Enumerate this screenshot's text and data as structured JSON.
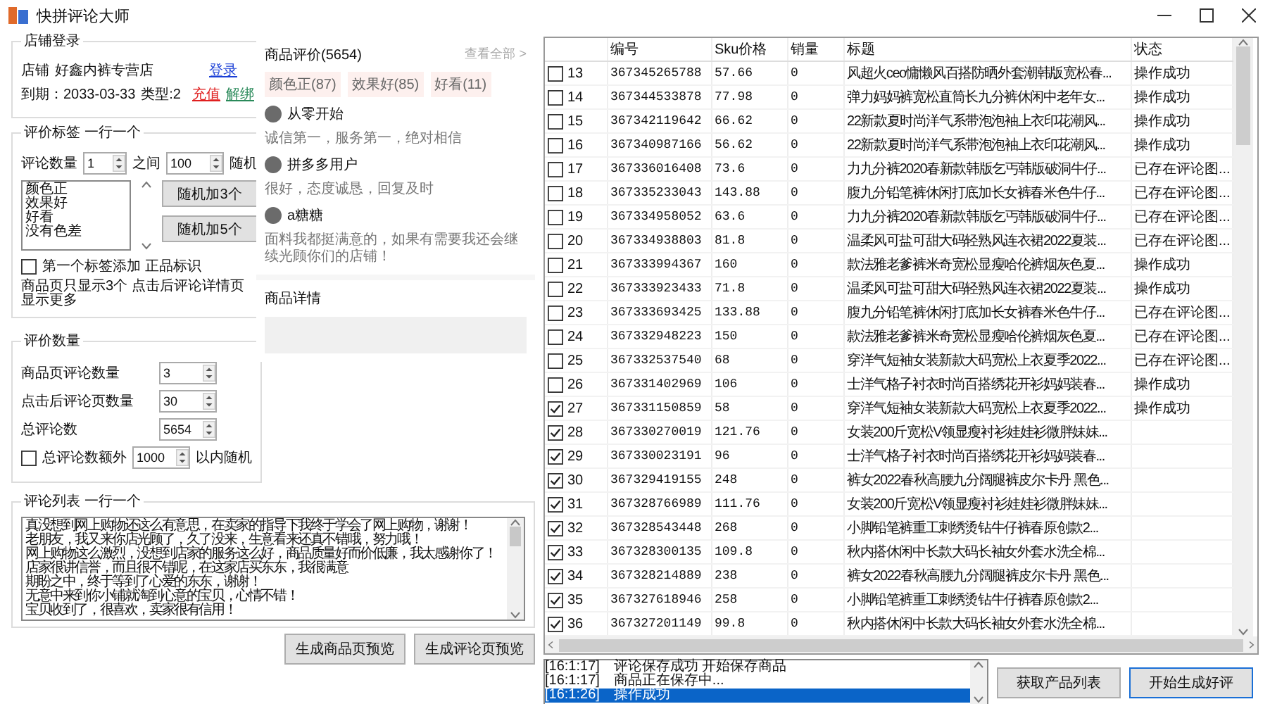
{
  "window": {
    "title": "快拼评论大师"
  },
  "shop_login": {
    "title": "店铺登录",
    "shop_label": "店铺",
    "shop_name": "好鑫内裤专营店",
    "login_link": "登录",
    "expiry": "到期：2033-03-33",
    "type": "类型:2",
    "recharge_link": "充值",
    "unbind_link": "解绑"
  },
  "tags_group": {
    "title": "评价标签 一行一个",
    "count_label": "评论数量",
    "min": "1",
    "between_label": "之间",
    "max": "100",
    "random_label": "随机",
    "tags": [
      "颜色正",
      "效果好",
      "好看",
      "没有色差"
    ],
    "buttons": [
      "随机加3个",
      "随机加5个"
    ],
    "first_tag_checkbox": {
      "label": "第一个标签添加 正品标识",
      "checked": false
    },
    "note": "商品页只显示3个 点击后评论详情页显示更多"
  },
  "count_group": {
    "title": "评价数量",
    "fields": [
      {
        "label": "商品页评论数量",
        "value": "3"
      },
      {
        "label": "点击后评论页数量",
        "value": "30"
      },
      {
        "label": "总评论数",
        "value": "5654"
      }
    ],
    "extra_checkbox": {
      "label": "总评论数额外",
      "checked": false
    },
    "extra_value": "1000",
    "extra_suffix": "以内随机"
  },
  "preview": {
    "title": "商品评价(5654)",
    "view_all": "查看全部 >",
    "tags": [
      "颜色正(87)",
      "效果好(85)",
      "好看(11)"
    ],
    "reviews": [
      {
        "user": "从零开始",
        "text": "诚信第一，服务第一，绝对相信"
      },
      {
        "user": "拼多多用户",
        "text": "很好，态度诚恳，回复及时"
      },
      {
        "user": "a糖糖",
        "text": "面料我都挺满意的，如果有需要我还会继续光顾你们的店铺！"
      }
    ],
    "details_title": "商品详情"
  },
  "comment_list": {
    "title": "评论列表 一行一个",
    "lines": [
      "真没想到网上购物还这么有意思，在卖家的指导下我终于学会了网上购物，谢谢！",
      "老朋友，我又来你店光顾了，久了没来，生意看来还真不错哦，努力哦！",
      "网上购物这么激烈，没想到店家的服务这么好，商品质量好而价低廉，我太感谢你了！",
      "店家很讲信誉，而且很不错呢，在这家店买东东，我很满意",
      "期盼之中，终于等到了心爱的东东，谢谢！",
      "无意中来到你小铺就淘到心意的宝贝，心情不错！",
      "宝贝收到了，很喜欢，卖家很有信用！"
    ]
  },
  "left_buttons": [
    "生成商品页预览",
    "生成评论页预览"
  ],
  "table": {
    "columns": [
      "编号",
      "Sku价格",
      "销量",
      "标题",
      "状态"
    ],
    "rows": [
      {
        "checked": false,
        "index": "13",
        "id": "367345265788",
        "price": "57.66",
        "sales": "0",
        "title": "风超火ceo慵懒风百搭防晒外套潮韩版宽松春...",
        "status": "操作成功"
      },
      {
        "checked": false,
        "index": "14",
        "id": "367344533878",
        "price": "77.98",
        "sales": "0",
        "title": "弹力妈妈裤宽松直筒长九分裤休闲中老年女...",
        "status": "操作成功"
      },
      {
        "checked": false,
        "index": "15",
        "id": "367342119642",
        "price": "66.62",
        "sales": "0",
        "title": "22新款夏时尚洋气系带泡泡袖上衣印花潮风...",
        "status": "操作成功"
      },
      {
        "checked": false,
        "index": "16",
        "id": "367340987166",
        "price": "56.62",
        "sales": "0",
        "title": "22新款夏时尚洋气系带泡泡袖上衣印花潮风...",
        "status": "操作成功"
      },
      {
        "checked": false,
        "index": "17",
        "id": "367336016408",
        "price": "73.6",
        "sales": "0",
        "title": "力九分裤2020春新款韩版乞丐韩版破洞牛仔...",
        "status": "已存在评论图..."
      },
      {
        "checked": false,
        "index": "18",
        "id": "367335233043",
        "price": "143.88",
        "sales": "0",
        "title": "腹九分铅笔裤休闲打底加长女裤春米色牛仔...",
        "status": "已存在评论图..."
      },
      {
        "checked": false,
        "index": "19",
        "id": "367334958052",
        "price": "63.6",
        "sales": "0",
        "title": "力九分裤2020春新款韩版乞丐韩版破洞牛仔...",
        "status": "已存在评论图..."
      },
      {
        "checked": false,
        "index": "20",
        "id": "367334938803",
        "price": "81.8",
        "sales": "0",
        "title": "温柔风可盐可甜大码轻熟风连衣裙2022夏装...",
        "status": "已存在评论图..."
      },
      {
        "checked": false,
        "index": "21",
        "id": "367333994367",
        "price": "160",
        "sales": "0",
        "title": "款法雅老爹裤米奇宽松显瘦哈伦裤烟灰色夏...",
        "status": "操作成功"
      },
      {
        "checked": false,
        "index": "22",
        "id": "367333923433",
        "price": "71.8",
        "sales": "0",
        "title": "温柔风可盐可甜大码轻熟风连衣裙2022夏装...",
        "status": "操作成功"
      },
      {
        "checked": false,
        "index": "23",
        "id": "367333693425",
        "price": "133.88",
        "sales": "0",
        "title": "腹九分铅笔裤休闲打底加长女裤春米色牛仔...",
        "status": "已存在评论图..."
      },
      {
        "checked": false,
        "index": "24",
        "id": "367332948223",
        "price": "150",
        "sales": "0",
        "title": "款法雅老爹裤米奇宽松显瘦哈伦裤烟灰色夏...",
        "status": "已存在评论图..."
      },
      {
        "checked": false,
        "index": "25",
        "id": "367332537540",
        "price": "68",
        "sales": "0",
        "title": "穿洋气短袖女装新款大码宽松上衣夏季2022...",
        "status": "已存在评论图..."
      },
      {
        "checked": false,
        "index": "26",
        "id": "367331402969",
        "price": "106",
        "sales": "0",
        "title": "士洋气格子衬衣时尚百搭绣花开衫妈妈装春...",
        "status": "操作成功"
      },
      {
        "checked": true,
        "index": "27",
        "id": "367331150859",
        "price": "58",
        "sales": "0",
        "title": "穿洋气短袖女装新款大码宽松上衣夏季2022...",
        "status": "操作成功"
      },
      {
        "checked": true,
        "index": "28",
        "id": "367330270019",
        "price": "121.76",
        "sales": "0",
        "title": "女装200斤宽松V领显瘦衬衫娃娃衫微胖妹妹..."
      },
      {
        "checked": true,
        "index": "29",
        "id": "367330023191",
        "price": "96",
        "sales": "0",
        "title": "士洋气格子衬衣时尚百搭绣花开衫妈妈装春..."
      },
      {
        "checked": true,
        "index": "30",
        "id": "367329419155",
        "price": "248",
        "sales": "0",
        "title": "裤女2022春秋高腰九分阔腿裤皮尔卡丹 黑色..."
      },
      {
        "checked": true,
        "index": "31",
        "id": "367328766989",
        "price": "111.76",
        "sales": "0",
        "title": "女装200斤宽松V领显瘦衬衫娃娃衫微胖妹妹..."
      },
      {
        "checked": true,
        "index": "32",
        "id": "367328543448",
        "price": "268",
        "sales": "0",
        "title": "小脚铅笔裤重工刺绣烫钻牛仔裤春原创款2..."
      },
      {
        "checked": true,
        "index": "33",
        "id": "367328300135",
        "price": "109.8",
        "sales": "0",
        "title": "秋内搭休闲中长款大码长袖女外套水洗全棉..."
      },
      {
        "checked": true,
        "index": "34",
        "id": "367328214889",
        "price": "238",
        "sales": "0",
        "title": "裤女2022春秋高腰九分阔腿裤皮尔卡丹 黑色..."
      },
      {
        "checked": true,
        "index": "35",
        "id": "367327618946",
        "price": "258",
        "sales": "0",
        "title": "小脚铅笔裤重工刺绣烫钻牛仔裤春原创款2..."
      },
      {
        "checked": true,
        "index": "36",
        "id": "367327201149",
        "price": "99.8",
        "sales": "0",
        "title": "秋内搭休闲中长款大码长袖女外套水洗全棉..."
      }
    ]
  },
  "log": [
    {
      "time": "[16:1:17]",
      "message": "评论保存成功 开始保存商品",
      "selected": false
    },
    {
      "time": "[16:1:17]",
      "message": "商品正在保存中...",
      "selected": false
    },
    {
      "time": "[16:1:26]",
      "message": "操作成功",
      "selected": true
    }
  ],
  "right_buttons": [
    {
      "label": "获取产品列表",
      "default": false
    },
    {
      "label": "开始生成好评",
      "default": true
    }
  ]
}
